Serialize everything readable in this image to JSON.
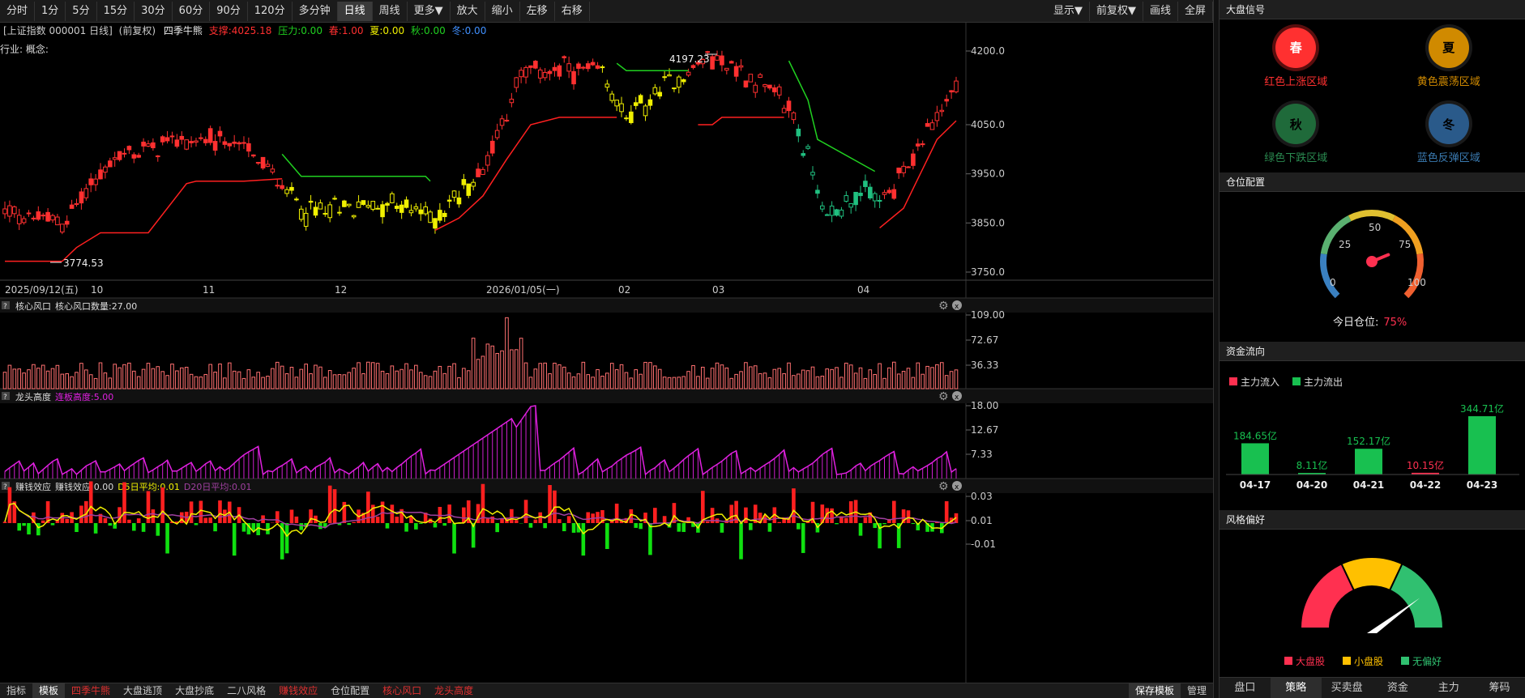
{
  "toolbar": {
    "periods": [
      "分时",
      "1分",
      "5分",
      "15分",
      "30分",
      "60分",
      "90分",
      "120分",
      "多分钟",
      "日线",
      "周线",
      "更多▼",
      "放大",
      "缩小",
      "左移",
      "右移"
    ],
    "active": "日线",
    "right": [
      "显示▼",
      "前复权▼",
      "画线",
      "全屏"
    ]
  },
  "info": {
    "name": "[上证指数 000001 日线]",
    "fq": "(前复权)",
    "indicator": "四季牛熊",
    "support_label": "支撑:",
    "support": "4025.18",
    "pressure_label": "压力:",
    "pressure": "0.00",
    "spring_label": "春:",
    "spring": "1.00",
    "summer_label": "夏:",
    "summer": "0.00",
    "autumn_label": "秋:",
    "autumn": "0.00",
    "winter_label": "冬:",
    "winter": "0.00"
  },
  "industry": "行业: 概念:",
  "price_axis": [
    "4200.0",
    "4050.0",
    "3950.0",
    "3850.0",
    "3750.0"
  ],
  "high_label": "4197.23",
  "low_label": "3774.53",
  "date_axis": [
    "2025/09/12(五)",
    "10",
    "11",
    "12",
    "2026/01/05(一)",
    "02",
    "03",
    "04"
  ],
  "panels": [
    {
      "title": "核心风口",
      "legend": [
        {
          "text": "核心风口数量:27.00",
          "color": "#ddd"
        }
      ],
      "axis": [
        "109.00",
        "72.67",
        "36.33"
      ]
    },
    {
      "title": "龙头高度",
      "legend": [
        {
          "text": "连板高度:5.00",
          "color": "#e020e0"
        }
      ],
      "axis": [
        "18.00",
        "12.67",
        "7.33"
      ]
    },
    {
      "title": "赚钱效应",
      "legend": [
        {
          "text": "赚钱效应:0.00",
          "color": "#ddd"
        },
        {
          "text": "D5日平均:0.01",
          "color": "#f0f000"
        },
        {
          "text": "D20日平均:0.01",
          "color": "#a040a0"
        }
      ],
      "axis": [
        "0.03",
        "0.01",
        "-0.01"
      ]
    }
  ],
  "bottom_tabs": [
    "指标",
    "模板",
    "四季牛熊",
    "大盘逃顶",
    "大盘抄底",
    "二八风格",
    "赚钱效应",
    "仓位配置",
    "核心风口",
    "龙头高度"
  ],
  "bottom_red": [
    "四季牛熊",
    "赚钱效应",
    "核心风口",
    "龙头高度"
  ],
  "bottom_right": [
    "保存模板",
    "管理"
  ],
  "side": {
    "signals_title": "大盘信号",
    "signals": [
      {
        "char": "春",
        "label": "红色上涨区域",
        "color": "#ff3030",
        "bright": true
      },
      {
        "char": "夏",
        "label": "黄色震荡区域",
        "color": "#d08a00",
        "bright": false
      },
      {
        "char": "秋",
        "label": "绿色下跌区域",
        "color": "#1f6a3a",
        "bright": false
      },
      {
        "char": "冬",
        "label": "蓝色反弹区域",
        "color": "#2a5a8a",
        "bright": false
      }
    ],
    "position_title": "仓位配置",
    "gauge": {
      "ticks": [
        "0",
        "25",
        "50",
        "75",
        "100"
      ],
      "value": 75,
      "label": "今日仓位:",
      "value_text": "75%"
    },
    "flow_title": "资金流向",
    "flow_legend": [
      {
        "text": "主力流入",
        "color": "#ff3050"
      },
      {
        "text": "主力流出",
        "color": "#18c050"
      }
    ],
    "flow": [
      {
        "date": "04-17",
        "label": "184.65亿",
        "value": 184.65,
        "dir": "out"
      },
      {
        "date": "04-20",
        "label": "8.11亿",
        "value": 8.11,
        "dir": "out"
      },
      {
        "date": "04-21",
        "label": "152.17亿",
        "value": 152.17,
        "dir": "out"
      },
      {
        "date": "04-22",
        "label": "10.15亿",
        "value": 10.15,
        "dir": "in"
      },
      {
        "date": "04-23",
        "label": "344.71亿",
        "value": 344.71,
        "dir": "out"
      }
    ],
    "style_title": "风格偏好",
    "style_legend": [
      {
        "text": "大盘股",
        "color": "#ff3050"
      },
      {
        "text": "小盘股",
        "color": "#ffc000"
      },
      {
        "text": "无偏好",
        "color": "#30c070"
      }
    ],
    "tabs": [
      "盘口",
      "策略",
      "买卖盘",
      "资金",
      "主力",
      "筹码"
    ],
    "active_tab": "策略"
  }
}
